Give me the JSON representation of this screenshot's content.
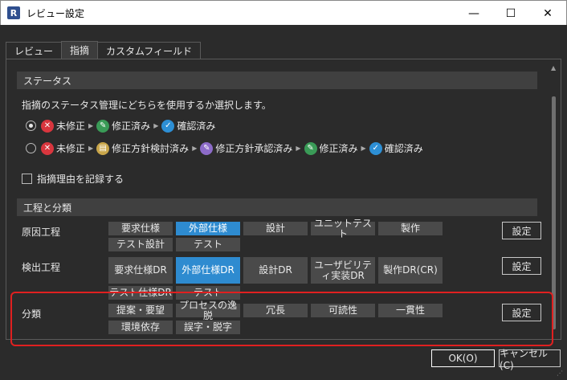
{
  "window": {
    "title": "レビュー設定",
    "app_letter": "R",
    "minimize": "—",
    "maximize": "☐",
    "close": "✕"
  },
  "tabs": [
    "レビュー",
    "指摘",
    "カスタムフィールド"
  ],
  "status": {
    "header": "ステータス",
    "description": "指摘のステータス管理にどちらを使用するか選択します。",
    "flow1": [
      "未修正",
      "修正済み",
      "確認済み"
    ],
    "flow2": [
      "未修正",
      "修正方針検討済み",
      "修正方針承認済み",
      "修正済み",
      "確認済み"
    ],
    "record_reason": "指摘理由を記録する"
  },
  "process": {
    "header": "工程と分類",
    "cause_label": "原因工程",
    "cause_items": [
      "要求仕様",
      "外部仕様",
      "設計",
      "ユニットテスト",
      "製作",
      "テスト設計",
      "テスト"
    ],
    "detect_label": "検出工程",
    "detect_items": [
      "要求仕様DR",
      "外部仕様DR",
      "設計DR",
      "ユーザビリティ実装DR",
      "製作DR(CR)",
      "テスト仕様DR",
      "テスト"
    ],
    "category_label": "分類",
    "category_items": [
      "提案・要望",
      "プロセスの逸脱",
      "冗長",
      "可読性",
      "一貫性",
      "環境依存",
      "誤字・脱字"
    ],
    "settings_label": "設定"
  },
  "footer": {
    "ok": "OK(O)",
    "cancel": "キャンセル(C)"
  },
  "colors": {
    "selected": "#2e8bd0",
    "highlight_frame": "#e02020"
  }
}
